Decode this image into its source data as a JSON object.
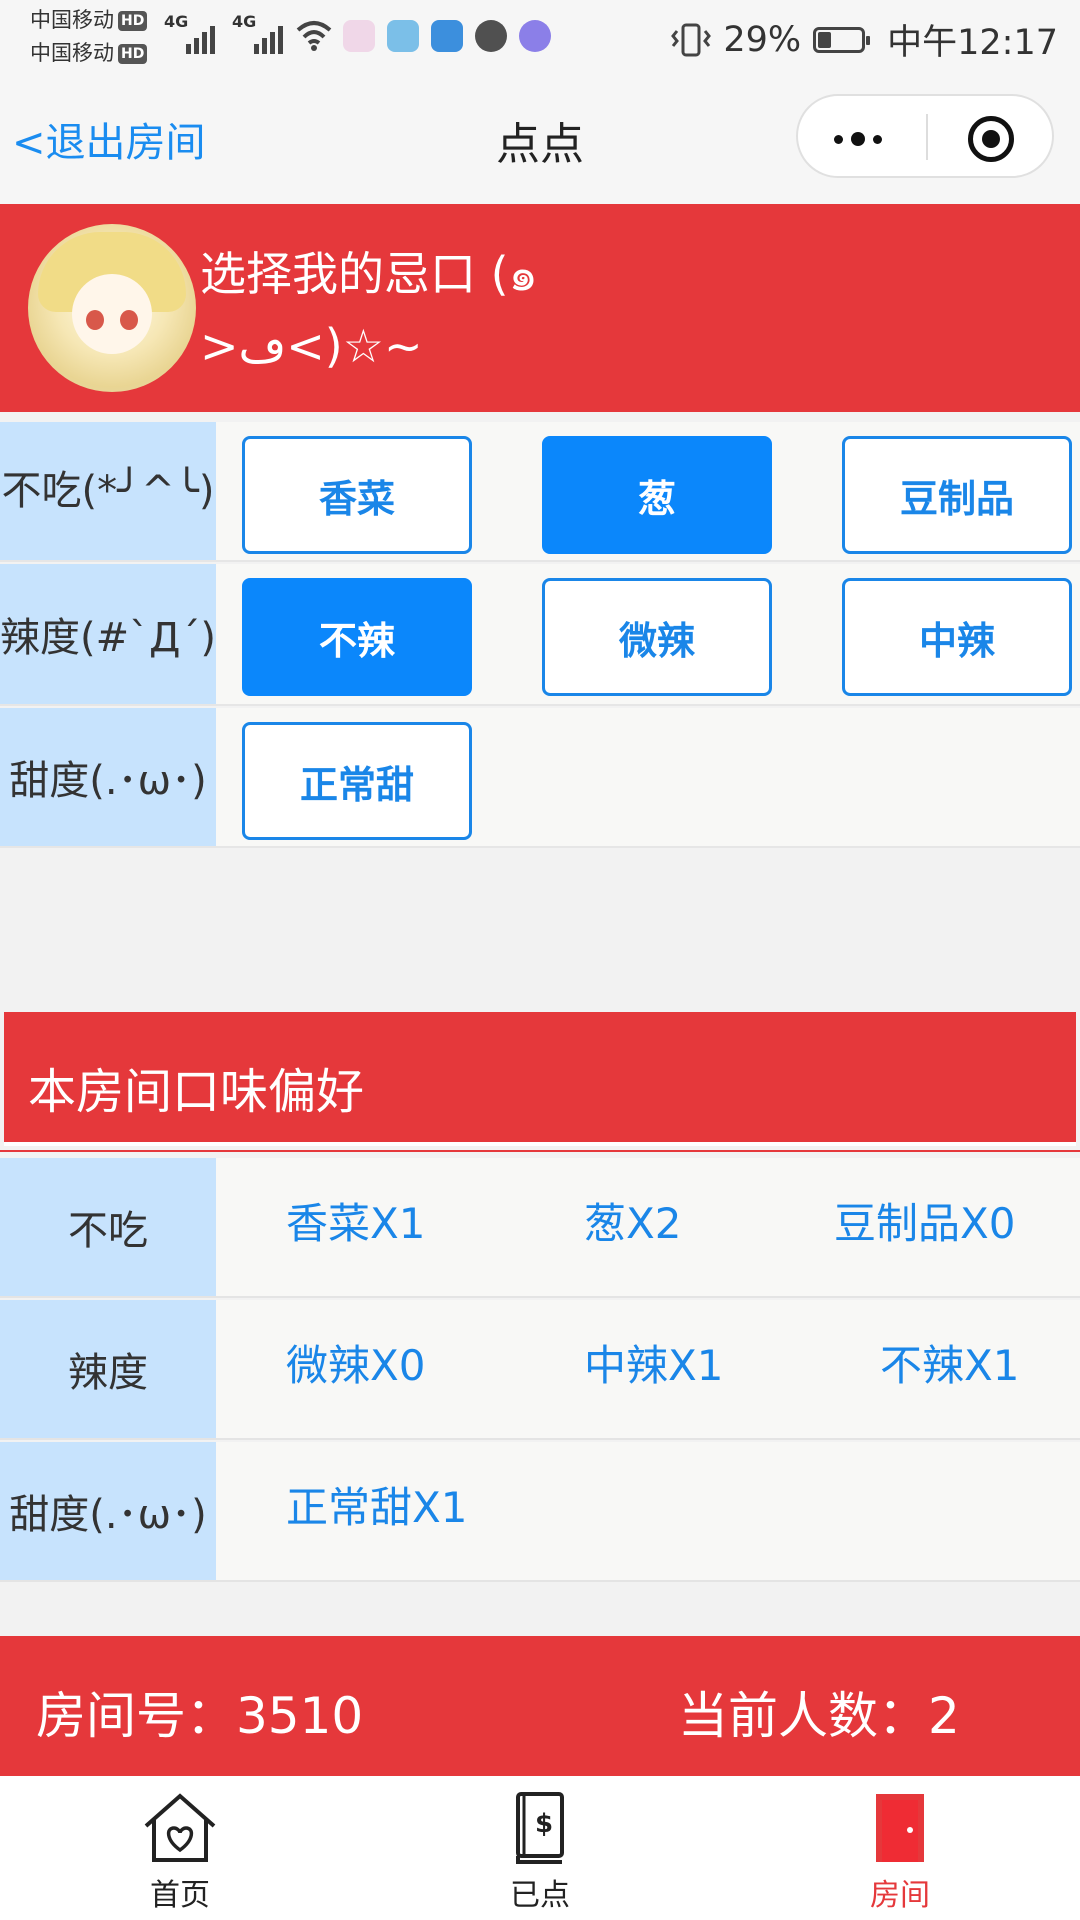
{
  "status_bar": {
    "carrier1": "中国移动",
    "carrier2": "中国移动",
    "hd": "HD",
    "net1": "4G",
    "net2": "4G",
    "battery": "29%",
    "time": "中午12:17"
  },
  "navbar": {
    "back_label": "<退出房间",
    "title": "点点"
  },
  "header": {
    "title": "选择我的忌口 (๑ >ڡ<)☆~"
  },
  "options": {
    "rows": [
      {
        "label": "不吃(*╯^╰)",
        "choices": [
          {
            "label": "香菜"
          },
          {
            "label": "葱"
          },
          {
            "label": "豆制品"
          }
        ]
      },
      {
        "label": "辣度(#`Д´)",
        "choices": [
          {
            "label": "不辣"
          },
          {
            "label": "微辣"
          },
          {
            "label": "中辣"
          }
        ]
      },
      {
        "label": "甜度(.･ω･)",
        "choices": [
          {
            "label": "正常甜"
          }
        ]
      }
    ],
    "selected": [
      "葱",
      "不辣"
    ]
  },
  "preferences": {
    "title": "本房间口味偏好",
    "rows": [
      {
        "label": "不吃",
        "values": [
          "香菜X1",
          "葱X2",
          "豆制品X0"
        ]
      },
      {
        "label": "辣度",
        "values": [
          "微辣X0",
          "中辣X1",
          "不辣X1"
        ]
      },
      {
        "label": "甜度(.･ω･)",
        "values": [
          "正常甜X1"
        ]
      }
    ]
  },
  "footer": {
    "room_number": "房间号：3510",
    "people_count": "当前人数：2"
  },
  "tabbar": {
    "items": [
      {
        "label": "首页",
        "icon": "home-heart-icon"
      },
      {
        "label": "已点",
        "icon": "menu-book-icon"
      },
      {
        "label": "房间",
        "icon": "door-icon"
      }
    ],
    "active": "房间"
  },
  "colors": {
    "accent_red": "#e5383b",
    "accent_blue": "#0b87fb",
    "label_bg": "#c7e3fd"
  }
}
